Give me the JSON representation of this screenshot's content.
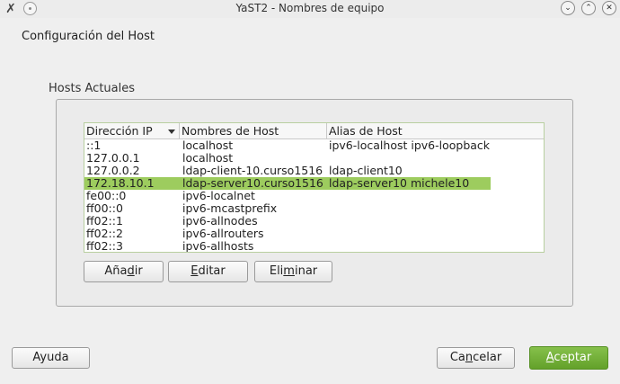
{
  "window": {
    "title": "YaST2 - Nombres de equipo",
    "app_icon": "yast-icon",
    "pin_icon": "pin-icon",
    "controls": [
      "minimize-icon",
      "maximize-icon",
      "close-icon"
    ],
    "minimize_glyph": "⌄",
    "maximize_glyph": "⌃",
    "close_glyph": "✕",
    "app_glyph": "✗"
  },
  "heading": "Configuración del Host",
  "group": {
    "label": "Hosts Actuales"
  },
  "table": {
    "columns": [
      "Dirección IP",
      "Nombres de Host",
      "Alias de Host"
    ],
    "sorted_column": 0,
    "selected_row": 3,
    "selection_color": "#9dcc5e",
    "rows": [
      [
        "::1",
        "localhost",
        "ipv6-localhost ipv6-loopback"
      ],
      [
        "127.0.0.1",
        "localhost",
        ""
      ],
      [
        "127.0.0.2",
        "ldap-client-10.curso1516",
        "ldap-client10"
      ],
      [
        "172.18.10.1",
        "ldap-server10.curso1516",
        "ldap-server10 michele10"
      ],
      [
        "fe00::0",
        "ipv6-localnet",
        ""
      ],
      [
        "ff00::0",
        "ipv6-mcastprefix",
        ""
      ],
      [
        "ff02::1",
        "ipv6-allnodes",
        ""
      ],
      [
        "ff02::2",
        "ipv6-allrouters",
        ""
      ],
      [
        "ff02::3",
        "ipv6-allhosts",
        ""
      ]
    ]
  },
  "buttons": {
    "add": {
      "pre": "Aña",
      "mnemonic": "d",
      "post": "ir"
    },
    "edit": {
      "pre": "",
      "mnemonic": "E",
      "post": "ditar"
    },
    "delete": {
      "pre": "Eli",
      "mnemonic": "m",
      "post": "inar"
    },
    "help": {
      "label": "Ayuda"
    },
    "cancel": {
      "pre": "Ca",
      "mnemonic": "n",
      "post": "celar"
    },
    "accept": {
      "pre": "",
      "mnemonic": "A",
      "post": "ceptar"
    }
  },
  "colors": {
    "accent": "#6aab32",
    "background": "#efefef"
  }
}
